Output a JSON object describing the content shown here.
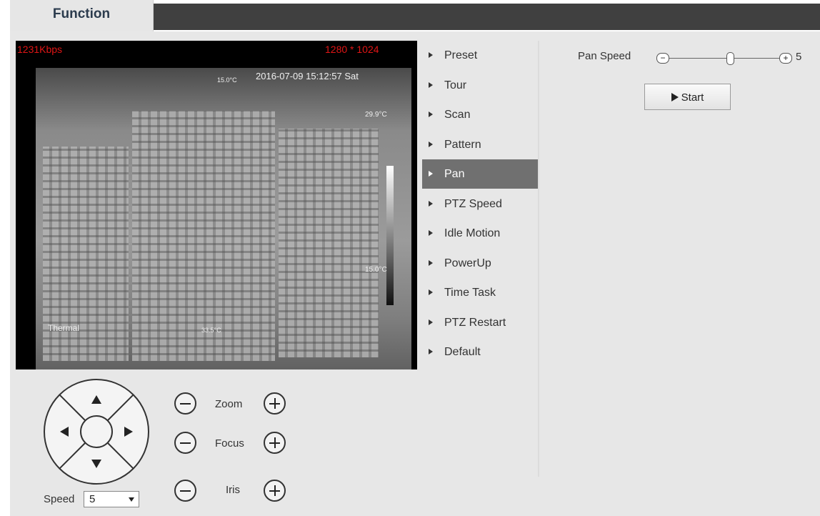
{
  "tab": {
    "label": "Function"
  },
  "video": {
    "bitrate": "1231Kbps",
    "resolution": "1280 * 1024",
    "timestamp": "2016-07-09 15:12:57 Sat",
    "channel": "Thermal",
    "temp_marker_top": "15.0°C",
    "temp_marker_bottom": "33.5°C",
    "scale_max": "29.9°C",
    "scale_min": "15.0°C"
  },
  "menu": {
    "items": [
      {
        "label": "Preset"
      },
      {
        "label": "Tour"
      },
      {
        "label": "Scan"
      },
      {
        "label": "Pattern"
      },
      {
        "label": "Pan"
      },
      {
        "label": "PTZ Speed"
      },
      {
        "label": "Idle Motion"
      },
      {
        "label": "PowerUp"
      },
      {
        "label": "Time Task"
      },
      {
        "label": "PTZ Restart"
      },
      {
        "label": "Default"
      }
    ],
    "active": "Pan"
  },
  "pan": {
    "speed_label": "Pan Speed",
    "speed_value": "5",
    "start_label": "Start"
  },
  "ptz": {
    "zoom_label": "Zoom",
    "focus_label": "Focus",
    "iris_label": "Iris",
    "speed_label": "Speed",
    "speed_value": "5"
  }
}
